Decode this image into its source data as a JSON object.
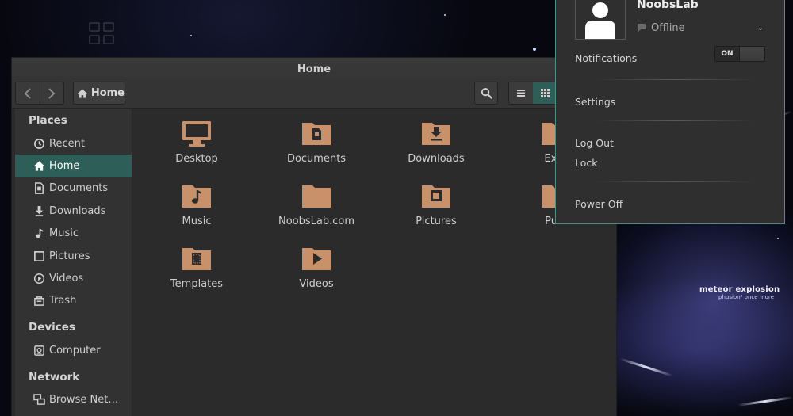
{
  "window": {
    "title": "Home"
  },
  "toolbar": {
    "back_icon": "chevron-left-icon",
    "forward_icon": "chevron-right-icon",
    "path_label": "Home",
    "search_icon": "search-icon",
    "view_list_icon": "list-view-icon",
    "view_grid_icon": "grid-view-icon"
  },
  "sidebar": {
    "places_heading": "Places",
    "places": [
      {
        "label": "Recent",
        "icon": "clock-icon"
      },
      {
        "label": "Home",
        "icon": "home-icon",
        "active": true
      },
      {
        "label": "Documents",
        "icon": "document-icon"
      },
      {
        "label": "Downloads",
        "icon": "download-icon"
      },
      {
        "label": "Music",
        "icon": "music-note-icon"
      },
      {
        "label": "Pictures",
        "icon": "picture-icon"
      },
      {
        "label": "Videos",
        "icon": "play-icon"
      },
      {
        "label": "Trash",
        "icon": "trash-icon"
      }
    ],
    "devices_heading": "Devices",
    "devices": [
      {
        "label": "Computer",
        "icon": "drive-icon"
      }
    ],
    "network_heading": "Network",
    "network": [
      {
        "label": "Browse Net…",
        "icon": "network-icon"
      }
    ]
  },
  "files": [
    {
      "name": "Desktop",
      "icon": "desktop-folder-icon"
    },
    {
      "name": "Documents",
      "icon": "documents-folder-icon"
    },
    {
      "name": "Downloads",
      "icon": "downloads-folder-icon"
    },
    {
      "name": "Exar",
      "icon": "folder-icon"
    },
    {
      "name": "Music",
      "icon": "music-folder-icon"
    },
    {
      "name": "NoobsLab.com",
      "icon": "folder-icon"
    },
    {
      "name": "Pictures",
      "icon": "pictures-folder-icon"
    },
    {
      "name": "Publ",
      "icon": "public-folder-icon"
    },
    {
      "name": "Templates",
      "icon": "templates-folder-icon"
    },
    {
      "name": "Videos",
      "icon": "videos-folder-icon"
    }
  ],
  "user_menu": {
    "username": "NoobsLab",
    "presence": "Offline",
    "notifications_label": "Notifications",
    "notifications_state": "ON",
    "settings_label": "Settings",
    "logout_label": "Log Out",
    "lock_label": "Lock",
    "poweroff_label": "Power Off"
  },
  "wallpaper": {
    "title": "meteor explosion",
    "subtitle": "phusion² once more"
  },
  "colors": {
    "accent": "#2d5e58",
    "folder": "#c9916a",
    "window_bg": "#2b2b2b",
    "sidebar_bg": "#323232",
    "menu_border": "#4f8d85"
  }
}
